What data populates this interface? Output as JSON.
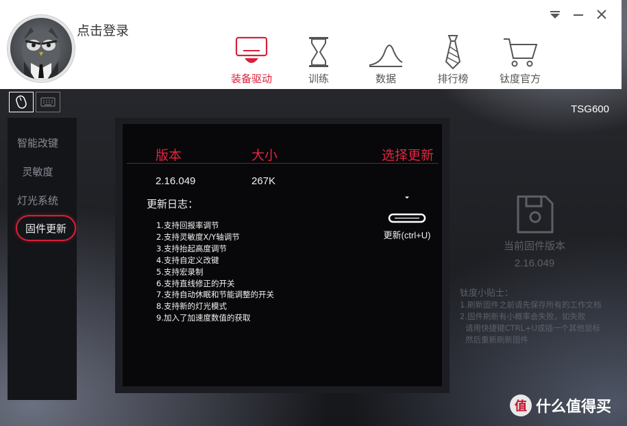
{
  "header": {
    "login_text": "点击登录",
    "nav": [
      {
        "label": "装备驱动",
        "icon": "mouse-driver-icon",
        "active": true
      },
      {
        "label": "训练",
        "icon": "hourglass-icon",
        "active": false
      },
      {
        "label": "数据",
        "icon": "chart-curve-icon",
        "active": false
      },
      {
        "label": "排行榜",
        "icon": "tie-icon",
        "active": false
      },
      {
        "label": "钛度官方",
        "icon": "shopping-cart-icon",
        "active": false
      }
    ]
  },
  "device": {
    "tabs": [
      {
        "icon": "mouse-icon",
        "active": true
      },
      {
        "icon": "keyboard-icon",
        "active": false
      }
    ],
    "model": "TSG600"
  },
  "sidebar": {
    "items": [
      {
        "label": "智能改键",
        "active": false
      },
      {
        "label": "灵敏度",
        "active": false
      },
      {
        "label": "灯光系统",
        "active": false
      },
      {
        "label": "固件更新",
        "active": true
      }
    ]
  },
  "firmware": {
    "col_version": "版本",
    "col_size": "大小",
    "col_select": "选择更新",
    "version": "2.16.049",
    "size": "267K",
    "log_title": "更新日志：",
    "log": [
      "1.支持回报率调节",
      "2.支持灵敏度X/Y轴调节",
      "3.支持抬起高度调节",
      "4.支持自定义改键",
      "5.支持宏录制",
      "6.支持直线修正的开关",
      "7.支持自动休眠和节能调整的开关",
      "8.支持新的灯光模式",
      "9.加入了加速度数值的获取"
    ],
    "update_label": "更新(ctrl+U)"
  },
  "current": {
    "label": "当前固件版本",
    "version": "2.16.049",
    "tips_title": "钛度小贴士：",
    "tips": [
      "1.刷新固件之前请先保存所有的工作文档",
      "2.固件刷新有小概率会失败，如失败",
      "请用快捷键CTRL+U或插一个其他鼠标",
      "然后重新刷新固件"
    ]
  },
  "watermark": {
    "logo": "值",
    "text": "什么值得买"
  },
  "colors": {
    "accent": "#d8203a",
    "header_bg": "#ffffff",
    "panel_bg": "#08080a"
  }
}
